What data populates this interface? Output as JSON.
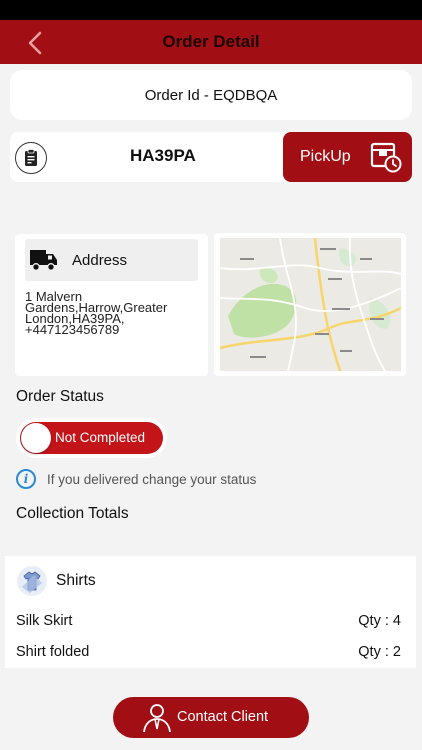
{
  "header": {
    "title": "Order Detail"
  },
  "order": {
    "id_label": "Order Id - EQDBQA",
    "code": "HA39PA",
    "pickup_label": "PickUp"
  },
  "address": {
    "label": "Address",
    "text": "1 Malvern Gardens,Harrow,Greater London,HA39PA, +447123456789"
  },
  "status": {
    "section_title": "Order Status",
    "toggle_label": "Not Completed",
    "info_text": "If you delivered change your status"
  },
  "totals": {
    "section_title": "Collection Totals",
    "category": "Shirts",
    "items": [
      {
        "name": "Silk Skirt",
        "qty": "Qty : 4"
      },
      {
        "name": "Shirt folded",
        "qty": "Qty : 2"
      }
    ]
  },
  "contact": {
    "label": "Contact Client"
  },
  "icons": {
    "back": "chevron-left-icon",
    "order_code": "clipboard-icon",
    "pickup": "delivery-box-clock-icon",
    "address": "delivery-truck-icon",
    "info": "info-icon",
    "category": "shirt-icon",
    "contact": "person-icon"
  },
  "colors": {
    "brand": "#a10f14",
    "toggle_off": "#c3141a",
    "info": "#2a8ad2",
    "background": "#f3f3f3"
  }
}
